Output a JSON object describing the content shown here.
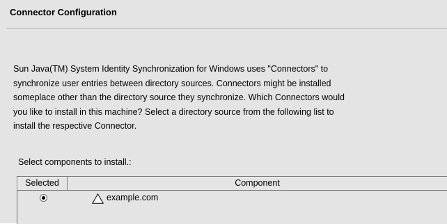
{
  "header": {
    "title": "Connector Configuration"
  },
  "description": {
    "lines": [
      "Sun Java(TM) System Identity Synchronization for Windows uses \"Connectors\" to",
      "synchronize user entries between directory sources. Connectors might be installed",
      "someplace other than the directory source they synchronize. Which Connectors would",
      "you like to install in this machine? Select a directory source from the following list to",
      "install the respective Connector."
    ]
  },
  "select_label": "Select components to install.:",
  "table": {
    "columns": {
      "selected": "Selected",
      "component": "Component"
    },
    "rows": [
      {
        "selected": true,
        "icon": "warning-triangle-icon",
        "component": "example.com"
      }
    ]
  },
  "colors": {
    "panel_background": "#e4e4e4",
    "border": "#6b6b6b",
    "text": "#000000"
  }
}
